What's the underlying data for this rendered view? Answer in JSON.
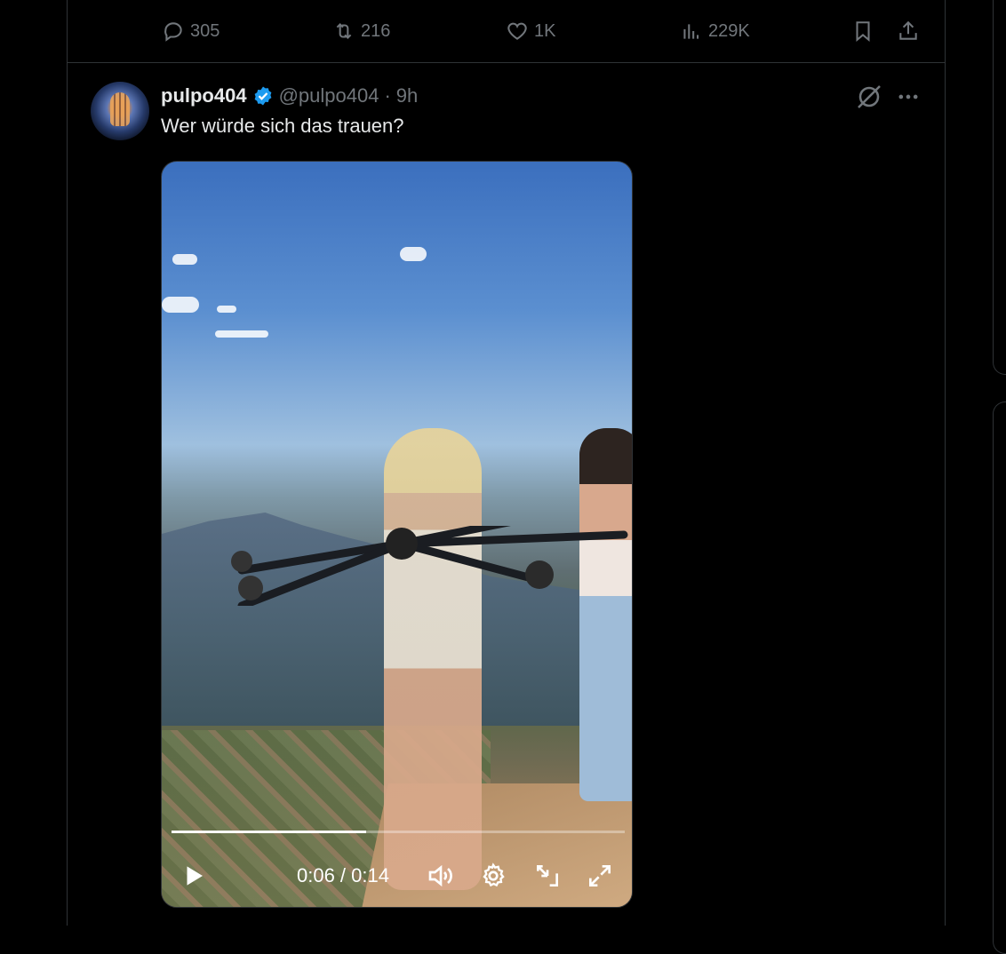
{
  "actions": {
    "replies": "305",
    "reposts": "216",
    "likes": "1K",
    "views": "229K"
  },
  "tweet": {
    "display_name": "pulpo404",
    "handle": "@pulpo404",
    "separator": "·",
    "time": "9h",
    "text": "Wer würde sich das trauen?"
  },
  "video": {
    "time_display": "0:06 / 0:14",
    "progress": 0.43
  },
  "colors": {
    "background": "#000000",
    "text": "#e7e9ea",
    "muted": "#71767b",
    "verified": "#1d9bf0",
    "border": "#2f3336"
  }
}
